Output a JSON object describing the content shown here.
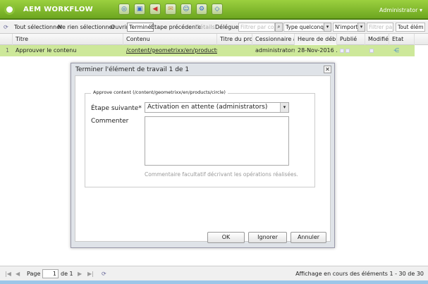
{
  "header": {
    "title": "AEM WORKFLOW",
    "user": "Administrator ▾",
    "nav_icons": [
      "websites-icon",
      "assets-icon",
      "campaigns-icon",
      "inbox-icon",
      "users-icon",
      "tools-icon",
      "tagging-icon"
    ]
  },
  "toolbar": {
    "select_all": "Tout sélectionner",
    "select_none": "Ne rien sélectionner",
    "open": "Ouvrir",
    "complete": "Terminé",
    "step_back": "Étape précédente",
    "details": "Détails",
    "delegate": "Déléguer",
    "filter_content_placeholder": "Filtrer par conte",
    "type_value": "Type quelconqu",
    "any_value": "N'importe",
    "filter_placeholder": "Filtrer par",
    "all_items": "Tout élém"
  },
  "columns": [
    "Titre",
    "Contenu",
    "Titre du proc",
    "Cessionnaire a...",
    "Heure de débu...",
    "Publié",
    "Modifié",
    "Etat"
  ],
  "rows": [
    {
      "num": "1",
      "title": "Approuver le contenu",
      "content": "/content/geometrixx/en/products/circle",
      "process": "",
      "assignee": "administrators",
      "start": "28-Nov-2016 ..."
    }
  ],
  "dialog": {
    "title": "Terminer l'élément de travail 1 de 1",
    "legend": "Approve content (/content/geometrixx/en/products/circle)",
    "next_step_label": "Étape suivante*",
    "next_step_value": "Activation en attente (administrators)",
    "comment_label": "Commenter",
    "comment_value": "",
    "hint": "Commentaire facultatif décrivant les opérations réalisées.",
    "ok": "OK",
    "ignore": "Ignorer",
    "cancel": "Annuler"
  },
  "footer": {
    "page_label": "Page",
    "page": "1",
    "of": "de 1",
    "status": "Affichage en cours des éléments 1 - 30 de 30"
  }
}
